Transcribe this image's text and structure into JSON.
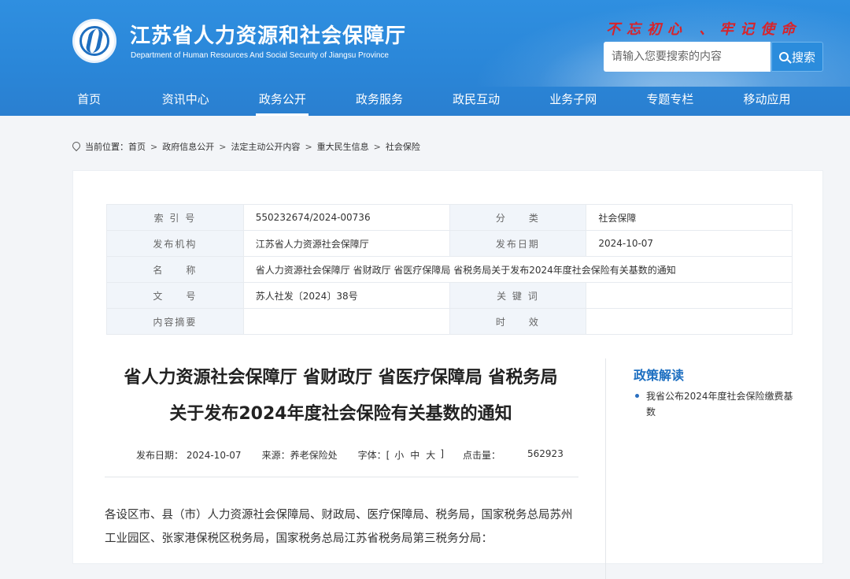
{
  "header": {
    "title": "江苏省人力资源和社会保障厅",
    "subtitle": "Department of Human Resources And Social Security of Jiangsu Province",
    "slogan": "不忘初心 、牢记使命",
    "search_placeholder": "请输入您要搜索的内容",
    "search_button": "搜索"
  },
  "nav": [
    "首页",
    "资讯中心",
    "政务公开",
    "政务服务",
    "政民互动",
    "业务子网",
    "专题专栏",
    "移动应用"
  ],
  "nav_active": "政务公开",
  "breadcrumb": {
    "label": "当前位置：",
    "items": [
      "首页",
      "政府信息公开",
      "法定主动公开内容",
      "重大民生信息",
      "社会保险"
    ]
  },
  "meta": {
    "index_label": "索 引 号",
    "index_value": "550232674/2024-00736",
    "category_label": "分　　类",
    "category_value": "社会保障",
    "publisher_label": "发布机构",
    "publisher_value": "江苏省人力资源社会保障厅",
    "date_label": "发布日期",
    "date_value": "2024-10-07",
    "name_label": "名　　称",
    "name_value": "省人力资源社会保障厅 省财政厅 省医疗保障局 省税务局关于发布2024年度社会保险有关基数的通知",
    "docno_label": "文　　号",
    "docno_value": "苏人社发〔2024〕38号",
    "keyword_label": "关 键 词",
    "keyword_value": "",
    "summary_label": "内容摘要",
    "summary_value": "",
    "validity_label": "时　　效",
    "validity_value": ""
  },
  "article": {
    "title_line1": "省人力资源社会保障厅 省财政厅 省医疗保障局 省税务局",
    "title_line2": "关于发布2024年度社会保险有关基数的通知",
    "date": "发布日期：  2024-10-07",
    "source": "来源：养老保险处",
    "font_label": "字体：[",
    "font_small": "小",
    "font_medium": "中",
    "font_large": "大",
    "font_close": "]",
    "hits_label": "点击量：",
    "hits_value": "562923",
    "body": "各设区市、县（市）人力资源社会保障局、财政局、医疗保障局、税务局，国家税务总局苏州工业园区、张家港保税区税务局，国家税务总局江苏省税务局第三税务分局："
  },
  "sidebar": {
    "title": "政策解读",
    "items": [
      "我省公布2024年度社会保险缴费基数"
    ]
  }
}
